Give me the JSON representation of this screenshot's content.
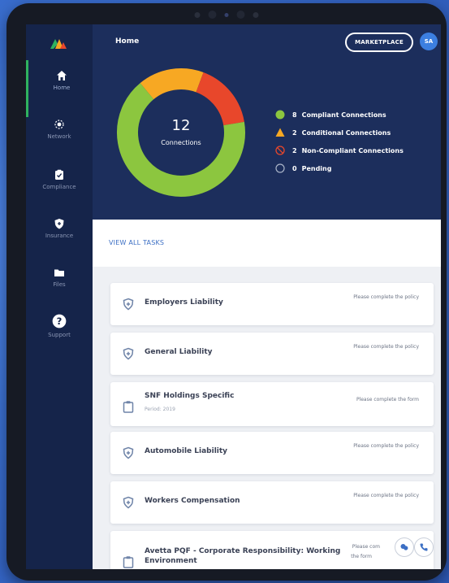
{
  "header": {
    "title": "Home",
    "marketplace_label": "MARKETPLACE",
    "avatar_initials": "SA"
  },
  "sidebar": {
    "items": [
      {
        "label": "Home",
        "icon": "home-icon",
        "active": true
      },
      {
        "label": "Network",
        "icon": "network-icon",
        "active": false
      },
      {
        "label": "Compliance",
        "icon": "compliance-icon",
        "active": false
      },
      {
        "label": "Insurance",
        "icon": "shield-icon",
        "active": false
      },
      {
        "label": "Files",
        "icon": "folder-icon",
        "active": false
      },
      {
        "label": "Support",
        "icon": "help-icon",
        "active": false
      }
    ]
  },
  "summary": {
    "total": "12",
    "total_label": "Connections",
    "legend": [
      {
        "count": "8",
        "label": "Compliant Connections",
        "color": "#8cc63f",
        "icon": "circle-icon"
      },
      {
        "count": "2",
        "label": "Conditional Connections",
        "color": "#f7a823",
        "icon": "triangle-icon"
      },
      {
        "count": "2",
        "label": "Non-Compliant Connections",
        "color": "#e8472b",
        "icon": "prohibited-icon"
      },
      {
        "count": "0",
        "label": "Pending",
        "color": "#aab4c8",
        "icon": "empty-circle-icon"
      }
    ]
  },
  "tasks": {
    "view_all_label": "VIEW ALL TASKS",
    "items": [
      {
        "title": "Employers Liability",
        "subtitle": "",
        "status": "Please complete the policy",
        "icon": "shield-icon"
      },
      {
        "title": "General Liability",
        "subtitle": "",
        "status": "Please complete the policy",
        "icon": "shield-icon"
      },
      {
        "title": "SNF Holdings Specific",
        "subtitle": "Period: 2019",
        "status": "Please complete the form",
        "icon": "clipboard-icon"
      },
      {
        "title": "Automobile Liability",
        "subtitle": "",
        "status": "Please complete the policy",
        "icon": "shield-icon"
      },
      {
        "title": "Workers Compensation",
        "subtitle": "",
        "status": "Please complete the policy",
        "icon": "shield-icon"
      },
      {
        "title": "Avetta PQF - Corporate Responsibility: Working Environment",
        "title_line1": "Avetta PQF - Corporate Responsibility: Working",
        "title_line2": "Environment",
        "subtitle": "",
        "status": "Please complete the form",
        "status_line1": "Please com",
        "status_line2": "the form",
        "icon": "clipboard-icon"
      }
    ]
  }
}
